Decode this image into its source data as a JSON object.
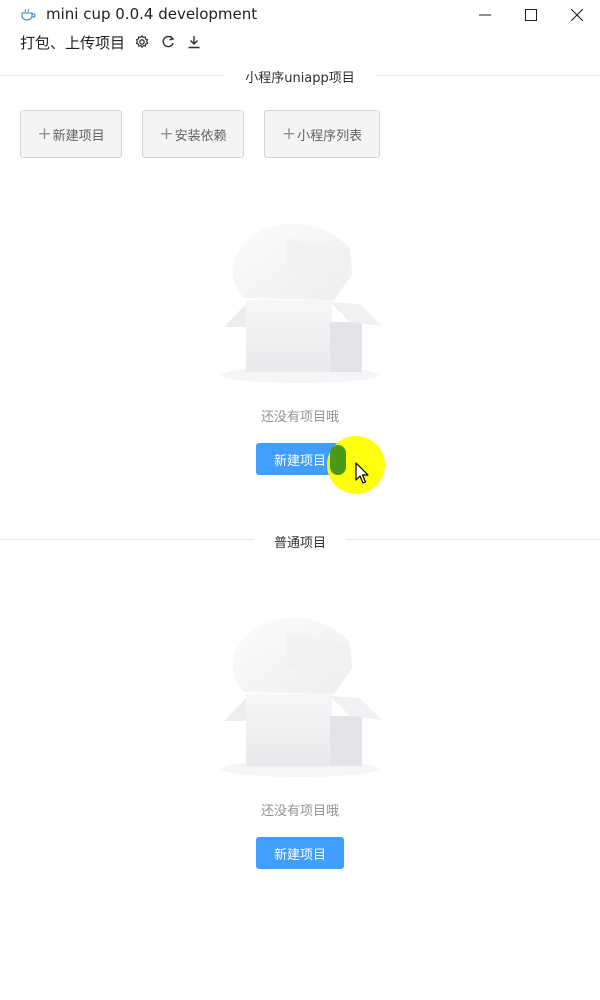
{
  "window": {
    "title": "mini cup 0.0.4 development"
  },
  "toolbar": {
    "label": "打包、上传项目",
    "icons": [
      "gear-icon",
      "refresh-icon",
      "download-icon"
    ]
  },
  "miniapp_section": {
    "title": "小程序uniapp项目",
    "buttons": [
      {
        "label": "新建项目"
      },
      {
        "label": "安装依赖"
      },
      {
        "label": "小程序列表"
      }
    ],
    "empty_text": "还没有项目哦",
    "create_label": "新建项目"
  },
  "normal_section": {
    "title": "普通项目",
    "empty_text": "还没有项目哦",
    "create_label": "新建项目"
  },
  "colors": {
    "primary": "#409eff",
    "cursor_highlight": "#ffff00"
  }
}
